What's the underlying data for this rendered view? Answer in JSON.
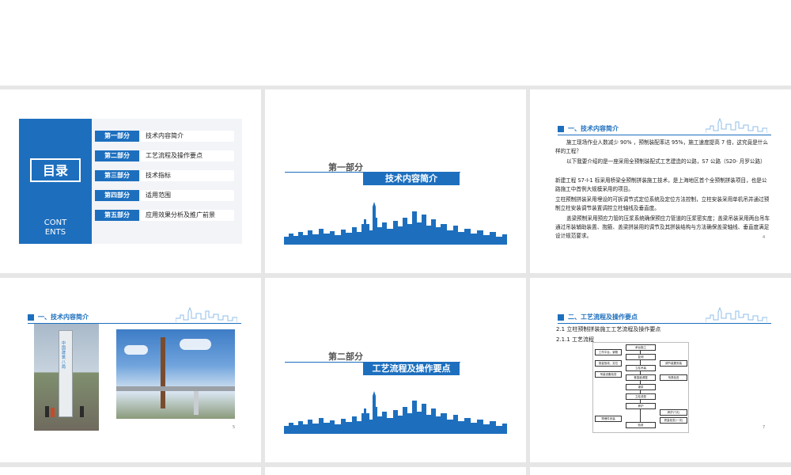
{
  "colors": {
    "accent": "#1d6fbe",
    "background": "#e6e6e6",
    "slide": "#ffffff"
  },
  "slide1": {
    "title": "目录",
    "subtitle": "CONT\nENTS",
    "items": [
      {
        "part": "第一部分",
        "label": "技术内容简介"
      },
      {
        "part": "第二部分",
        "label": "工艺流程及操作要点"
      },
      {
        "part": "第三部分",
        "label": "技术指标"
      },
      {
        "part": "第四部分",
        "label": "适用范围"
      },
      {
        "part": "第五部分",
        "label": "应用效果分析及推广前景"
      }
    ]
  },
  "slide2": {
    "part": "第一部分",
    "title": "技术内容简介"
  },
  "slide3": {
    "heading": "一、技术内容简介",
    "paragraphs": [
      "施工现场作业人数减少 90% ，预制装配率达 95%，施工速度提高 7 倍，这究竟是什么样的工程？",
      "以下我要介绍的是一座采用全预制装配式工艺建造的公路，S7 公路（S20- 月罗公路）",
      "新建工程 S7-I-1 标采用桥梁全预制拼装施工技术，是上海地区首个全预制拼装项目，也是公路施工中首例大规模采用的项目。",
      "立柱预制拼装采用埋设的可拆调节式定位系统及定位方法控制，立柱安装采用单机吊并通过预制立柱安装调节装置调控立柱轴线及垂直度。",
      "盖梁预制采用预应力管的压浆系统确保预应力管道的压浆密实度；盖梁吊装采用两台吊车通过吊装辅助装置、抱箍、盖梁拼装用的调节及其拼装结构与方法确保盖梁轴线、垂直度满足设计规范要求。"
    ],
    "page_number": "4"
  },
  "slide4": {
    "heading": "一、技术内容简介",
    "photo1_sign": "中国建筑八局",
    "page_number": "5"
  },
  "slide5": {
    "part": "第二部分",
    "title": "工艺流程及操作要点"
  },
  "slide6": {
    "heading": "二、工艺流程及操作要点",
    "sub1": "2.1 立柱预制拼装施工工艺流程及操作要点",
    "sub2": "2.1.1 工艺流程",
    "flow": {
      "main": [
        "承台施工",
        "复测",
        "立柱吊装",
        "垂直度调整",
        "灌浆",
        "立柱成型",
        "养护",
        "验收"
      ],
      "left": [
        "工作平台、钢筋",
        "测量放线、定位",
        "吊装设备检查",
        "预埋件安装"
      ],
      "right": [
        "调节装置安装",
        "吊具检查",
        "养护(7天)",
        "质量检查(一次)"
      ]
    },
    "page_number": "7"
  }
}
